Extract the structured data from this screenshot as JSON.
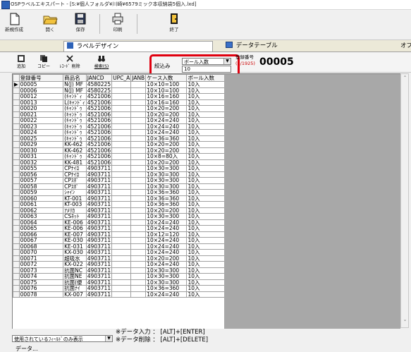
{
  "window": {
    "title": "OSPラベルエキスパート - [S:¥個人フォルダ¥川崎¥6579ミック本収納袋5個入.lxd]"
  },
  "toolbar": [
    {
      "label": "新規作成",
      "icon": "new-file-icon"
    },
    {
      "label": "開く",
      "icon": "open-folder-icon"
    },
    {
      "label": "保存",
      "icon": "save-icon"
    },
    {
      "label": "印刷",
      "icon": "print-icon"
    },
    {
      "label": "終了",
      "icon": "exit-icon"
    }
  ],
  "tabs": [
    {
      "label": "ラベルデザイン"
    },
    {
      "label": "データテーブル"
    },
    {
      "label": "オプ"
    }
  ],
  "subbar": {
    "buttons": [
      {
        "label": "追加",
        "icon": "add-icon"
      },
      {
        "label": "コピー",
        "icon": "copy-icon"
      },
      {
        "label": "ﾚｺｰﾄﾞ 削除",
        "icon": "delete-icon"
      },
      {
        "label": "検索(S)",
        "icon": "binoculars-icon"
      }
    ],
    "filter": {
      "label": "絞込み",
      "field": "ボール入数",
      "value": "10"
    },
    "reg": {
      "label": "登録番号",
      "count": "(1/1925)",
      "value": "00005"
    }
  },
  "grid": {
    "columns": [
      "登録番号",
      "商品名",
      "JANCD",
      "UPC_A",
      "JANB",
      "ケース入数",
      "ボール入数"
    ],
    "rows": [
      [
        "00005",
        "N(J) MF",
        "4580225",
        "",
        "",
        "10×10=100",
        "10入"
      ],
      [
        "00006",
        "N(J) MF",
        "4580225",
        "",
        "",
        "10×10=100",
        "10入"
      ],
      [
        "00012",
        "(ｷｬﾝﾄﾞｨ",
        "4521006",
        "",
        "",
        "10×16=160",
        "10入"
      ],
      [
        "00013",
        "L(ｷｬﾝﾄﾞｨ",
        "4521006",
        "",
        "",
        "10×16=160",
        "10入"
      ],
      [
        "00020",
        "(ｷｬﾝﾄﾞｩ",
        "4521006",
        "",
        "",
        "10×20=200",
        "10入"
      ],
      [
        "00021",
        "(ｷｬﾝﾄﾞｩ",
        "4521006",
        "",
        "",
        "10×20=200",
        "10入"
      ],
      [
        "00022",
        "(ｷｬﾝﾄﾞｩ",
        "4521006",
        "",
        "",
        "10×24=240",
        "10入"
      ],
      [
        "00023",
        "(ｷｬﾝﾄﾞｩ",
        "4521006",
        "",
        "",
        "10×24=240",
        "10入"
      ],
      [
        "00024",
        "(ｷｬﾝﾄﾞｩ",
        "4521006",
        "",
        "",
        "10×24=240",
        "10入"
      ],
      [
        "00025",
        "(ｷｬﾝﾄﾞｩ",
        "4521006",
        "",
        "",
        "10×36=360",
        "10入"
      ],
      [
        "00029",
        "KK-462",
        "4521006",
        "",
        "",
        "10×20=200",
        "10入"
      ],
      [
        "00030",
        "KK-462",
        "4521006",
        "",
        "",
        "10×20=200",
        "10入"
      ],
      [
        "00031",
        "(ｷｬﾝﾄﾞｩ",
        "4521006",
        "",
        "",
        "10×8=80入",
        "10入"
      ],
      [
        "00032",
        "KK-481",
        "4521006",
        "",
        "",
        "10×20=200",
        "10入"
      ],
      [
        "00055",
        "CPﾅｲﾛ",
        "4903711",
        "",
        "",
        "10×30=300",
        "10入"
      ],
      [
        "00056",
        "CPﾅｲﾛ",
        "4903711",
        "",
        "",
        "10×30=300",
        "10入"
      ],
      [
        "00057",
        "CPｽﾎﾟ",
        "4903711",
        "",
        "",
        "10×30=300",
        "10入"
      ],
      [
        "00058",
        "CPｽﾎﾟ",
        "4903711",
        "",
        "",
        "10×30=300",
        "10入"
      ],
      [
        "00059",
        "ｼｬｲﾝ",
        "4903711",
        "",
        "",
        "10×36=360",
        "10入"
      ],
      [
        "00060",
        "KT-001",
        "4903711",
        "",
        "",
        "10×36=360",
        "10入"
      ],
      [
        "00061",
        "KT-003",
        "4903711",
        "",
        "",
        "10×36=360",
        "10入"
      ],
      [
        "00062",
        "ｱﾒﾘｶ",
        "4903711",
        "",
        "",
        "10×20=200",
        "10入"
      ],
      [
        "00063",
        "CSﾈｯﾄ",
        "4903711",
        "",
        "",
        "10×30=300",
        "10入"
      ],
      [
        "00064",
        "KE-006",
        "4903711",
        "",
        "",
        "10×24=240",
        "10入"
      ],
      [
        "00065",
        "KE-006",
        "4903711",
        "",
        "",
        "10×24=240",
        "10入"
      ],
      [
        "00066",
        "KE-007",
        "4903711",
        "",
        "",
        "10×12=120",
        "10入"
      ],
      [
        "00067",
        "KE-030",
        "4903711",
        "",
        "",
        "10×24=240",
        "10入"
      ],
      [
        "00068",
        "KE-031",
        "4903711",
        "",
        "",
        "10×24=240",
        "10入"
      ],
      [
        "00070",
        "KX-030",
        "4903711",
        "",
        "",
        "10×24=240",
        "10入"
      ],
      [
        "00071",
        "超吸水",
        "4903711",
        "",
        "",
        "10×20=200",
        "10入"
      ],
      [
        "00072",
        "KX-022",
        "4903711",
        "",
        "",
        "10×24=240",
        "10入"
      ],
      [
        "00073",
        "抗菌NC",
        "4903711",
        "",
        "",
        "10×30=300",
        "10入"
      ],
      [
        "00074",
        "抗菌NE",
        "4903711",
        "",
        "",
        "10×30=300",
        "10入"
      ],
      [
        "00075",
        "抗菌(便",
        "4903711",
        "",
        "",
        "10×30=300",
        "10入"
      ],
      [
        "00076",
        "抗菌ﾅｲ",
        "4903711",
        "",
        "",
        "10×36=360",
        "10入"
      ],
      [
        "00078",
        "KX-007",
        "4903711",
        "",
        "",
        "10×24=240",
        "10入"
      ]
    ]
  },
  "bottom": {
    "select": "使用されているﾌｨｰﾙﾄﾞのみ表示",
    "hint1": "※データ入力 ： [ALT]+[ENTER]",
    "hint2": "※データ削除 ： [ALT]+[DELETE]",
    "button": "データ..."
  },
  "colors": {
    "highlight": "#e0000f",
    "count_red": "#cc0000",
    "grid_bg": "#a8a8a8"
  }
}
